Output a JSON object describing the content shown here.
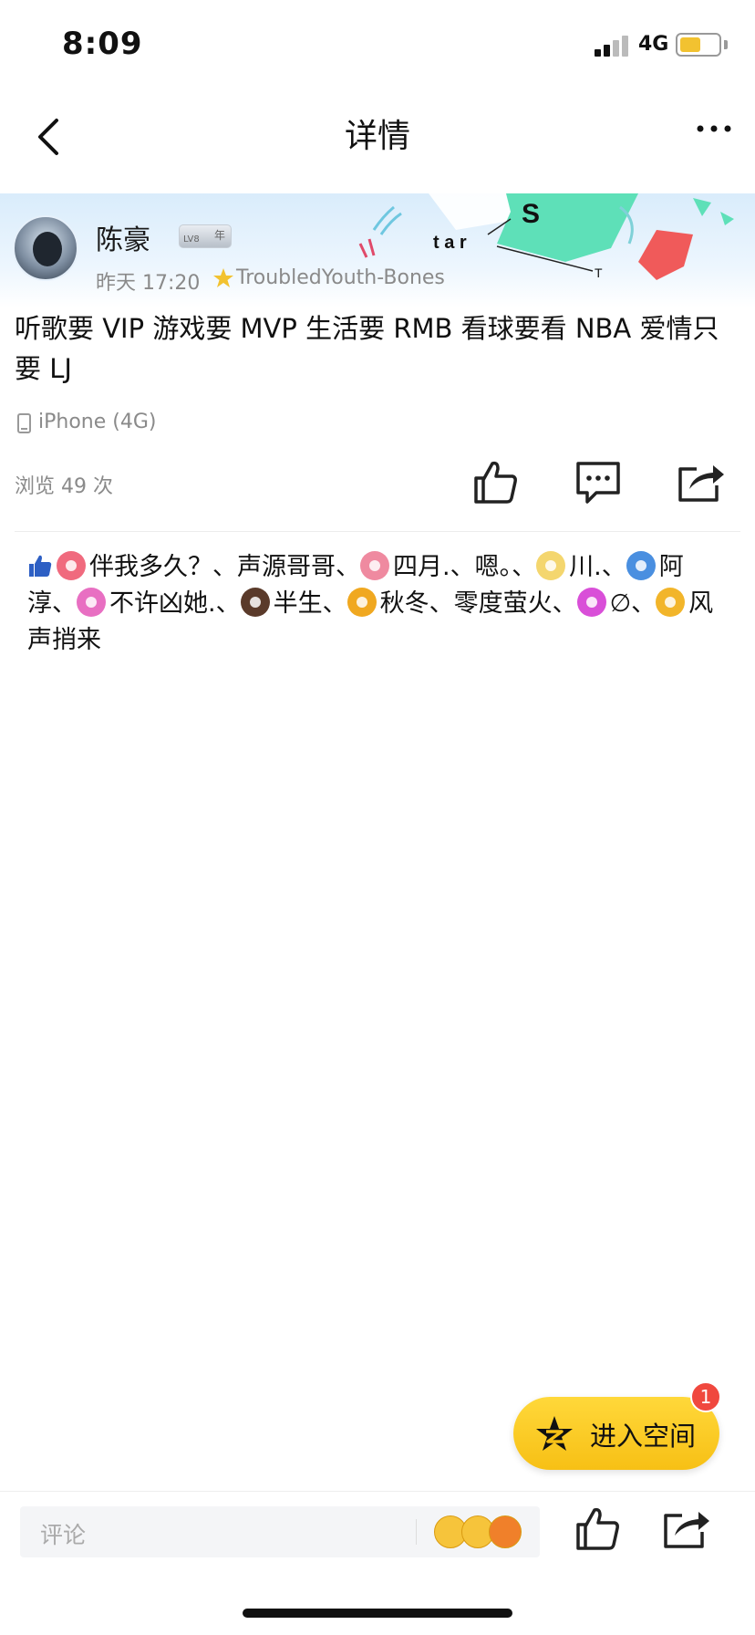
{
  "status_bar": {
    "time": "8:09",
    "network": "4G"
  },
  "nav": {
    "title": "详情"
  },
  "post": {
    "author": "陈豪",
    "level_badge": "LV8",
    "year_badge": "年",
    "time": "昨天 17:20",
    "music": "TroubledYouth-Bones",
    "text": "听歌要 VIP 游戏要 MVP 生活要 RMB 看球要看 NBA 爱情只要 LJ",
    "device": "iPhone (4G)",
    "views": "浏览 49 次",
    "banner_text": {
      "s": "S",
      "tar": "t a r",
      "t": "T"
    }
  },
  "likes": {
    "users": [
      {
        "name": "伴我多久？",
        "sep": "、",
        "color": "#f06a7e"
      },
      {
        "name": "声源哥哥",
        "sep": "、",
        "color": ""
      },
      {
        "name": "四月.",
        "sep": "、",
        "color": "#ef8aa0"
      },
      {
        "name": "嗯。",
        "sep": "、",
        "color": ""
      },
      {
        "name": "川.",
        "sep": "、",
        "color": "#f4d66e"
      },
      {
        "name": "阿淳",
        "sep": "、",
        "color": "#4a8fe0"
      },
      {
        "name": "不许凶她.",
        "sep": "、",
        "color": "#e86fc2"
      },
      {
        "name": "半生",
        "sep": "、",
        "color": "#5a3a2a"
      },
      {
        "name": "秋冬",
        "sep": "、",
        "color": "#f0a820"
      },
      {
        "name": "零度萤火",
        "sep": "、",
        "color": ""
      },
      {
        "name": "∅",
        "sep": "、",
        "color": "#d94fd8"
      },
      {
        "name": "风声捎来",
        "sep": "",
        "color": "#f2b52a"
      }
    ]
  },
  "floating": {
    "enter_label": "进入空间",
    "badge": "1"
  },
  "bottom": {
    "comment_placeholder": "评论"
  },
  "colors": {
    "accent_yellow": "#f7c015",
    "badge_red": "#f0483e",
    "like_blue": "#2d5fc4"
  }
}
